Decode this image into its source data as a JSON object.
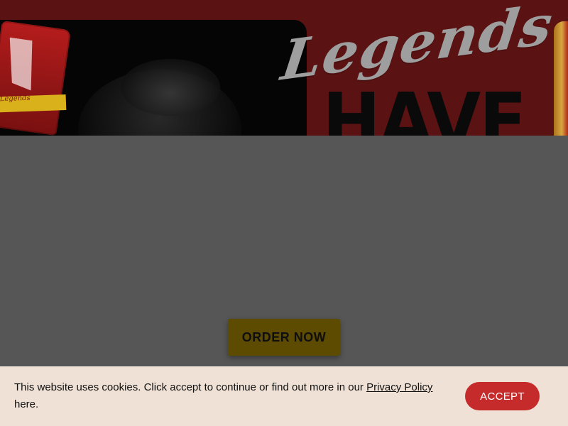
{
  "hero": {
    "script_text": "Legends",
    "headline": "HAVE",
    "bag_brand": "Legends"
  },
  "cta": {
    "label": "ORDER NOW"
  },
  "cookie_banner": {
    "message": "This website uses cookies. Click accept to continue or find out more in our",
    "link_label": "Privacy Policy",
    "suffix": "here.",
    "accept_label": "ACCEPT"
  },
  "colors": {
    "overlay": "#565656",
    "hero_background": "#5a1212",
    "cta_background": "#5d4b02",
    "cookie_background": "#efe1d5",
    "accept_background": "#c62b2b"
  }
}
